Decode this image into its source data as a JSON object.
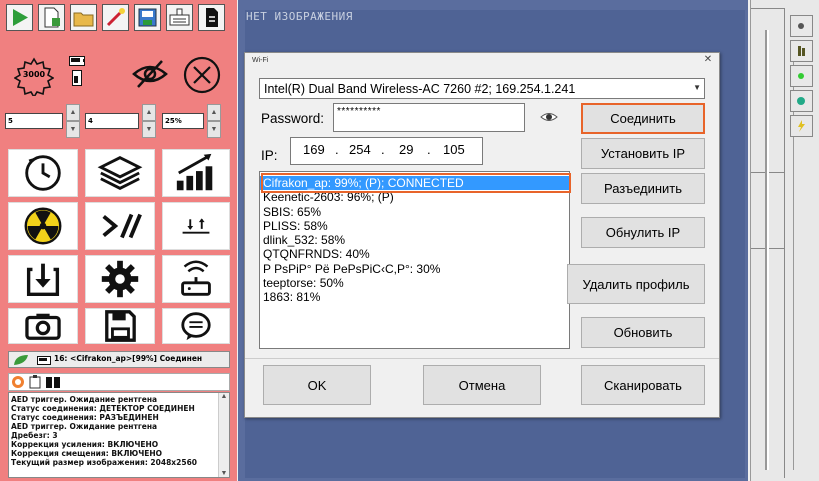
{
  "spinners": {
    "s1": "5",
    "s2": "4",
    "s3": "25%"
  },
  "gear_badge": "3000",
  "status_bar": {
    "text": "16: <Cifrakon_ap>[99%] Соединен"
  },
  "log": [
    "AED триггер. Ожидание рентгена",
    "Статус соединения: ДЕТЕКТОР СОЕДИНЕН",
    "Статус соединения: РАЗЪЕДИНЕН",
    "AED триггер. Ожидание рентгена",
    "Дребезг: 3",
    "Коррекция усиления: ВКЛЮЧЕНО",
    "Коррекция смещения: ВКЛЮЧЕНО",
    "Текущий размер изображения: 2048x2560"
  ],
  "image_area": {
    "no_image": "НЕТ ИЗОБРАЖЕНИЯ"
  },
  "dialog": {
    "title": "Wi-Fi",
    "adapter": "Intel(R) Dual Band Wireless-AC 7260 #2; 169.254.1.241",
    "password_label": "Password:",
    "password_value": "**********",
    "ip_label": "IP:",
    "ip": [
      "169",
      "254",
      "29",
      "105"
    ],
    "networks": [
      "Cifrakon_ap: 99%; (P); CONNECTED",
      "Keenetic-2603: 96%; (P)",
      "SBIS: 65%",
      "PLISS: 58%",
      "dlink_532: 58%",
      "QTQNFRNDS: 40%",
      "P PsPiP° Pë PePsPiC‹C,P°: 30%",
      "teeptorse: 50%",
      "1863: 81%"
    ],
    "buttons": {
      "connect": "Соединить",
      "set_ip": "Установить IP",
      "disconnect": "Разъединить",
      "reset_ip": "Обнулить IP",
      "delete_profile": "Удалить профиль",
      "refresh": "Обновить",
      "ok": "OK",
      "cancel": "Отмена",
      "scan": "Сканировать"
    }
  },
  "colors": {
    "left_panel": "#f08080",
    "image_bg": "#5a6d9e",
    "highlight": "#e8642a",
    "selection": "#3399ff"
  }
}
